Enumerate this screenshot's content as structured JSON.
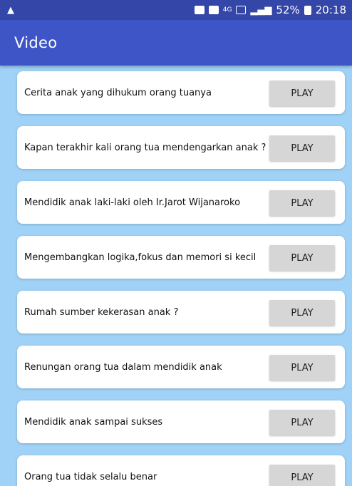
{
  "status_bar": {
    "left_icon": "warning-icon",
    "network": "4G",
    "battery_percent": "52%",
    "time": "20:18"
  },
  "app_bar": {
    "title": "Video"
  },
  "videos": [
    {
      "title": "Cerita anak yang dihukum orang tuanya",
      "button": "PLAY"
    },
    {
      "title": "Kapan terakhir kali orang tua mendengarkan anak ?",
      "button": "PLAY"
    },
    {
      "title": "Mendidik anak laki-laki oleh Ir.Jarot Wijanaroko",
      "button": "PLAY"
    },
    {
      "title": "Mengembangkan logika,fokus dan memori si kecil",
      "button": "PLAY"
    },
    {
      "title": "Rumah sumber kekerasan anak ?",
      "button": "PLAY"
    },
    {
      "title": "Renungan orang tua dalam mendidik anak",
      "button": "PLAY"
    },
    {
      "title": "Mendidik anak sampai sukses",
      "button": "PLAY"
    },
    {
      "title": "Orang tua tidak selalu benar",
      "button": "PLAY"
    }
  ],
  "colors": {
    "status_bar": "#3446a8",
    "app_bar": "#3d55c6",
    "background": "#9fd2f6",
    "button": "#d6d6d6"
  }
}
